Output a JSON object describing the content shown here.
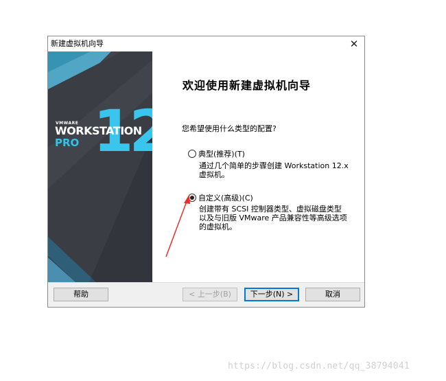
{
  "window": {
    "title": "新建虚拟机向导",
    "close_glyph": "✕"
  },
  "banner": {
    "brand_small": "VMWARE",
    "product": "WORKSTATION",
    "edition": "PRO",
    "version": "12",
    "accent_color": "#3ac5ec",
    "background_color": "#3a3d44"
  },
  "wizard": {
    "heading": "欢迎使用新建虚拟机向导",
    "question": "您希望使用什么类型的配置?",
    "options": [
      {
        "label": "典型(推荐)(T)",
        "selected": false,
        "desc_lines": [
          "通过几个简单的步骤创建 Workstation 12.x",
          "虚拟机。"
        ]
      },
      {
        "label": "自定义(高级)(C)",
        "selected": true,
        "desc_lines": [
          "创建带有 SCSI 控制器类型、虚拟磁盘类型",
          "以及与旧版 VMware 产品兼容性等高级选项",
          "的虚拟机。"
        ]
      }
    ]
  },
  "buttons": {
    "help": "帮助",
    "back": "< 上一步(B)",
    "next": "下一步(N) >",
    "cancel": "取消"
  },
  "annotation": {
    "arrow_color": "#e8302a"
  },
  "watermark": "https://blog.csdn.net/qq_38794041"
}
